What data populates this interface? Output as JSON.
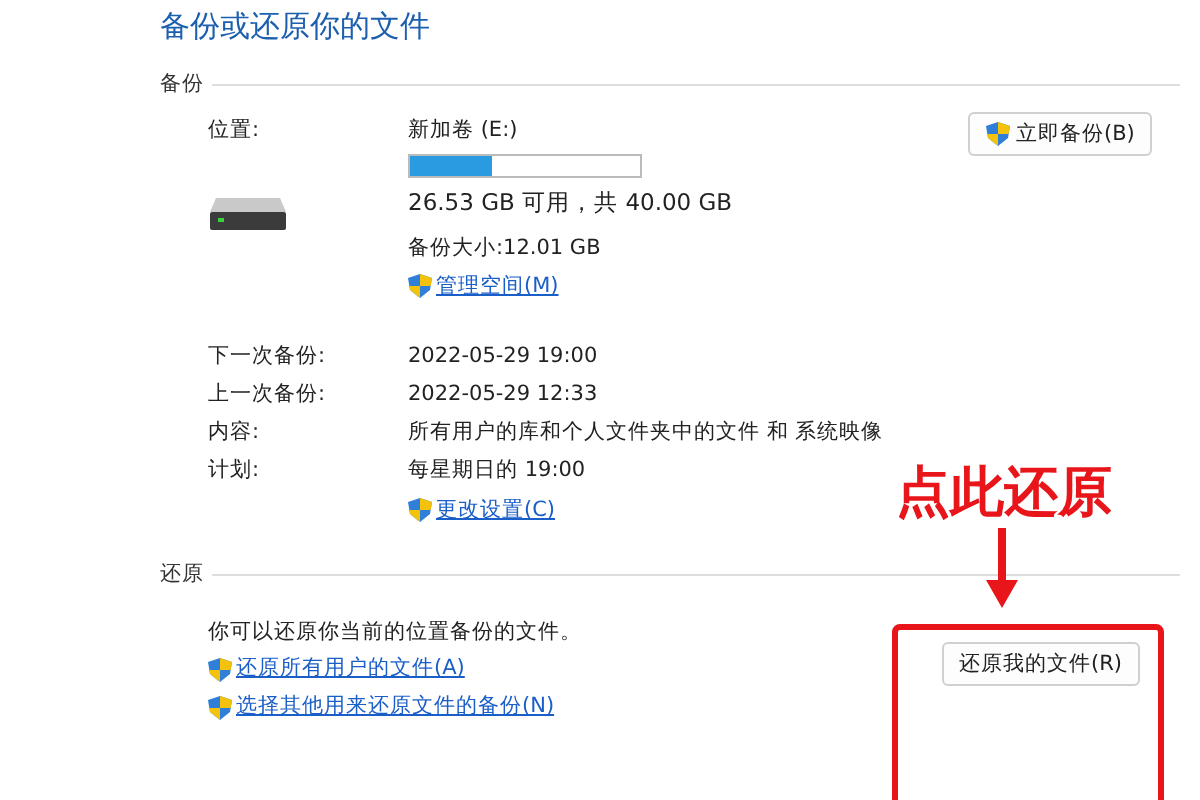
{
  "title": "备份或还原你的文件",
  "backup": {
    "heading": "备份",
    "location_label": "位置:",
    "volume": "新加卷 (E:)",
    "usage": {
      "level": 0.36
    },
    "free_space": "26.53 GB 可用，共 40.00 GB",
    "backup_size": "备份大小:12.01 GB",
    "manage_link": "管理空间(M)",
    "backup_now_button": "立即备份(B)",
    "details": [
      {
        "label": "下一次备份:",
        "value": "2022-05-29 19:00"
      },
      {
        "label": "上一次备份:",
        "value": "2022-05-29 12:33"
      },
      {
        "label": "内容:",
        "value": "所有用户的库和个人文件夹中的文件 和 系统映像"
      },
      {
        "label": "计划:",
        "value": "每星期日的 19:00"
      }
    ],
    "settings_link": "更改设置(C)"
  },
  "restore": {
    "heading": "还原",
    "description": "你可以还原你当前的位置备份的文件。",
    "links": [
      "还原所有用户的文件(A)",
      "选择其他用来还原文件的备份(N)"
    ],
    "restore_button": "还原我的文件(R)"
  },
  "annotation": {
    "text": "点此还原"
  }
}
